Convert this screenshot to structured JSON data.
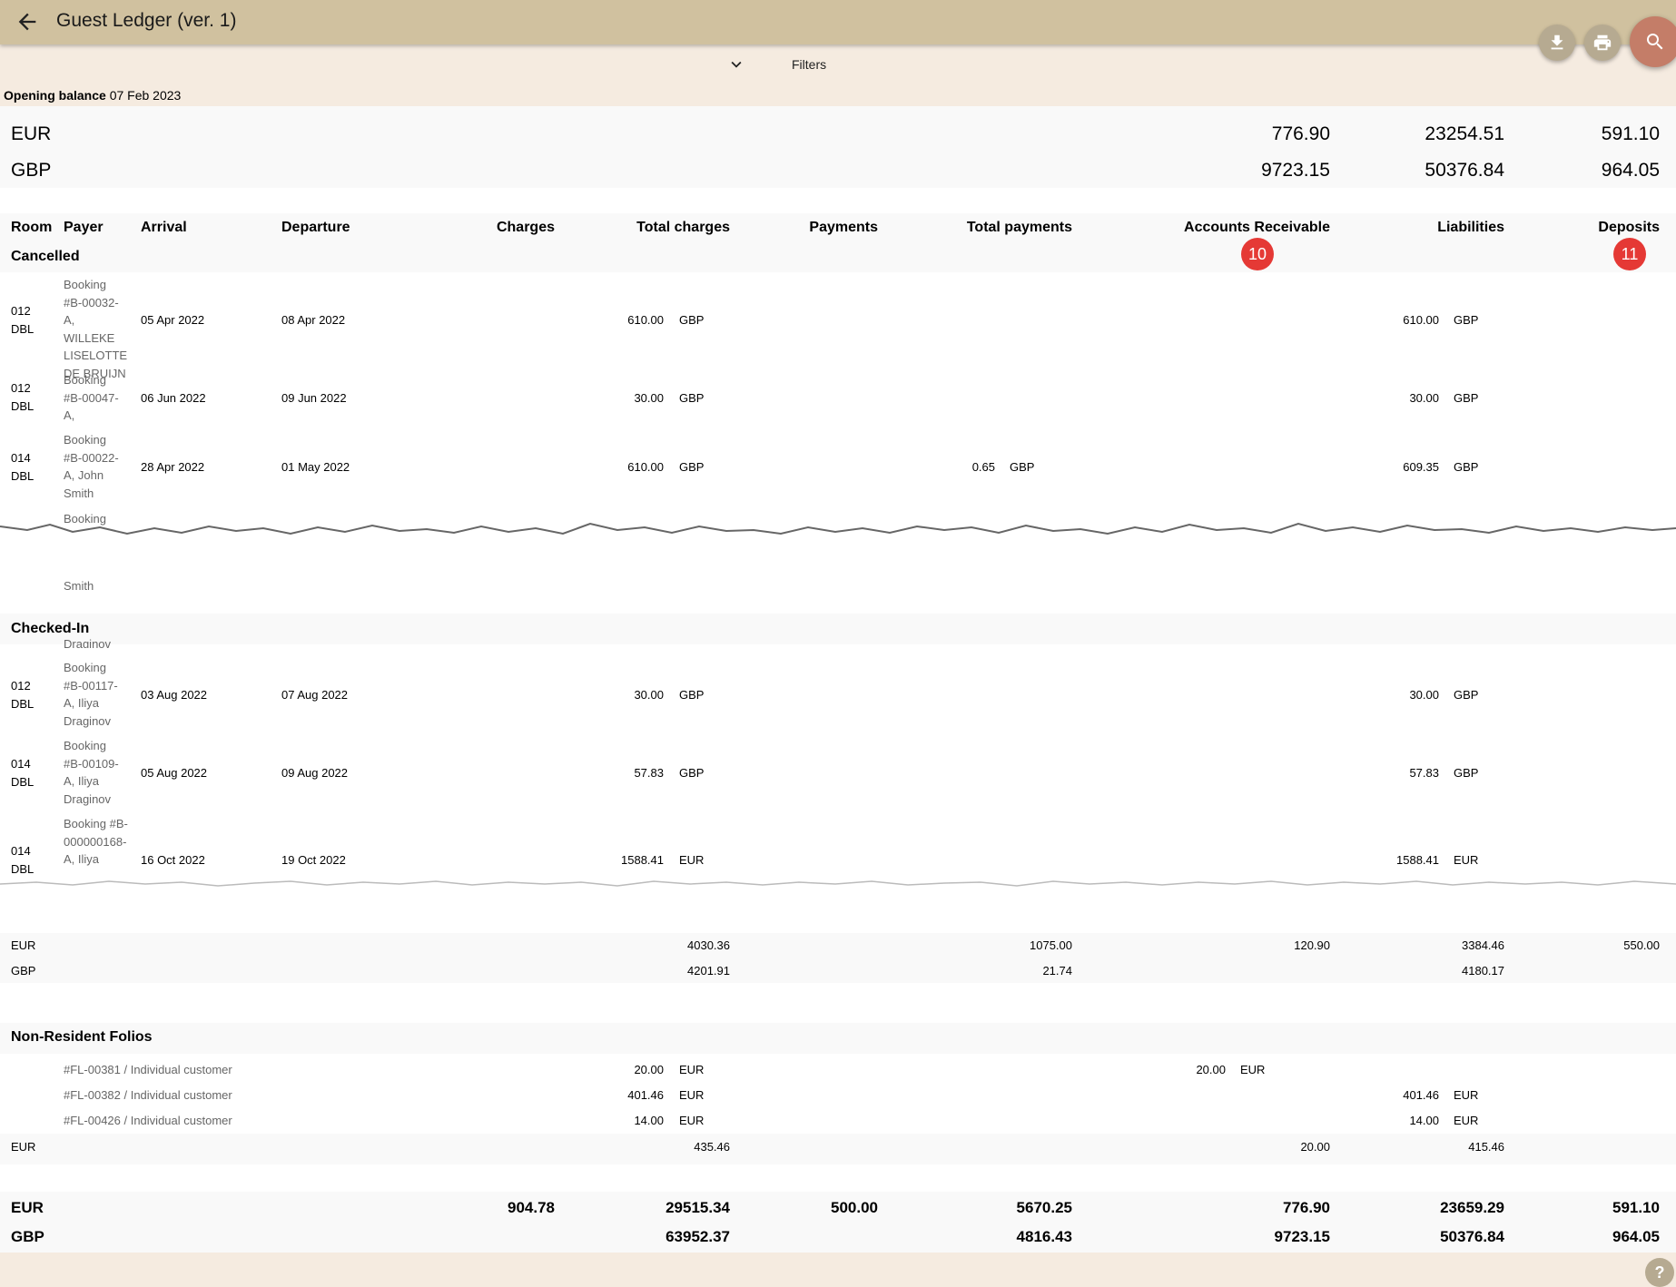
{
  "app": {
    "title": "Guest Ledger (ver. 1)",
    "filters_label": "Filters"
  },
  "opening": {
    "label": "Opening balance",
    "date": "07 Feb 2023"
  },
  "summary": [
    {
      "currency": "EUR",
      "ar": "776.90",
      "liab": "23254.51",
      "dep": "591.10"
    },
    {
      "currency": "GBP",
      "ar": "9723.15",
      "liab": "50376.84",
      "dep": "964.05"
    }
  ],
  "headers": {
    "room": "Room",
    "payer": "Payer",
    "arrival": "Arrival",
    "departure": "Departure",
    "charges": "Charges",
    "total_charges": "Total charges",
    "payments": "Payments",
    "total_payments": "Total payments",
    "ar": "Accounts Receivable",
    "liabilities": "Liabilities",
    "deposits": "Deposits"
  },
  "badges": {
    "ar": "10",
    "deposits": "11"
  },
  "cancelled": {
    "label": "Cancelled",
    "rows": [
      {
        "room": "012 DBL",
        "payer": "Booking #B-00032-A, WILLEKE LISELOTTE DE BRUIJN",
        "arrival": "05 Apr 2022",
        "departure": "08 Apr 2022",
        "total_charges": "610.00",
        "tc_cur": "GBP",
        "liab": "610.00",
        "liab_cur": "GBP"
      },
      {
        "room": "012 DBL",
        "payer": "Booking #B-00047-A,",
        "arrival": "06 Jun 2022",
        "departure": "09 Jun 2022",
        "total_charges": "30.00",
        "tc_cur": "GBP",
        "liab": "30.00",
        "liab_cur": "GBP"
      },
      {
        "room": "014 DBL",
        "payer": "Booking #B-00022-A, John Smith",
        "arrival": "28 Apr 2022",
        "departure": "01 May 2022",
        "total_charges": "610.00",
        "tc_cur": "GBP",
        "total_payments": "0.65",
        "tp_cur": "GBP",
        "liab": "609.35",
        "liab_cur": "GBP"
      }
    ],
    "partial_top": "Booking",
    "partial_bottom": "Smith"
  },
  "checked_in": {
    "label": "Checked-In",
    "partial_top": "Draginov",
    "rows": [
      {
        "room": "012 DBL",
        "payer": "Booking #B-00117-A, Iliya Draginov",
        "arrival": "03 Aug 2022",
        "departure": "07 Aug 2022",
        "total_charges": "30.00",
        "tc_cur": "GBP",
        "liab": "30.00",
        "liab_cur": "GBP"
      },
      {
        "room": "014 DBL",
        "payer": "Booking #B-00109-A, Iliya Draginov",
        "arrival": "05 Aug 2022",
        "departure": "09 Aug 2022",
        "total_charges": "57.83",
        "tc_cur": "GBP",
        "liab": "57.83",
        "liab_cur": "GBP"
      },
      {
        "room": "014 DBL",
        "payer": "Booking #B-000000168-A, Iliya",
        "arrival": "16 Oct 2022",
        "departure": "19 Oct 2022",
        "total_charges": "1588.41",
        "tc_cur": "EUR",
        "liab": "1588.41",
        "liab_cur": "EUR"
      }
    ],
    "totals": [
      {
        "currency": "EUR",
        "total_charges": "4030.36",
        "total_payments": "1075.00",
        "ar": "120.90",
        "liab": "3384.46",
        "dep": "550.00"
      },
      {
        "currency": "GBP",
        "total_charges": "4201.91",
        "total_payments": "21.74",
        "liab": "4180.17"
      }
    ]
  },
  "nonresident": {
    "label": "Non-Resident Folios",
    "rows": [
      {
        "payer": "#FL-00381 / Individual customer",
        "total_charges": "20.00",
        "tc_cur": "EUR",
        "ar": "20.00",
        "ar_cur": "EUR"
      },
      {
        "payer": "#FL-00382 / Individual customer",
        "total_charges": "401.46",
        "tc_cur": "EUR",
        "liab": "401.46",
        "liab_cur": "EUR"
      },
      {
        "payer": "#FL-00426 / Individual customer",
        "total_charges": "14.00",
        "tc_cur": "EUR",
        "liab": "14.00",
        "liab_cur": "EUR"
      }
    ],
    "totals": [
      {
        "currency": "EUR",
        "total_charges": "435.46",
        "ar": "20.00",
        "liab": "415.46"
      }
    ]
  },
  "grand_totals": [
    {
      "currency": "EUR",
      "charges": "904.78",
      "total_charges": "29515.34",
      "payments": "500.00",
      "total_payments": "5670.25",
      "ar": "776.90",
      "liab": "23659.29",
      "dep": "591.10"
    },
    {
      "currency": "GBP",
      "total_charges": "63952.37",
      "total_payments": "4816.43",
      "ar": "9723.15",
      "liab": "50376.84",
      "dep": "964.05"
    }
  ],
  "icons": {
    "back": "arrow-left-icon",
    "download": "download-icon",
    "print": "print-icon",
    "search": "search-icon",
    "chevron": "chevron-down-icon",
    "help": "help-icon"
  },
  "colors": {
    "topbar": "#d0c19f",
    "background": "#f5ebe0",
    "badge": "#e53935",
    "search_fab": "#c47d68",
    "payer_text": "#666666"
  }
}
